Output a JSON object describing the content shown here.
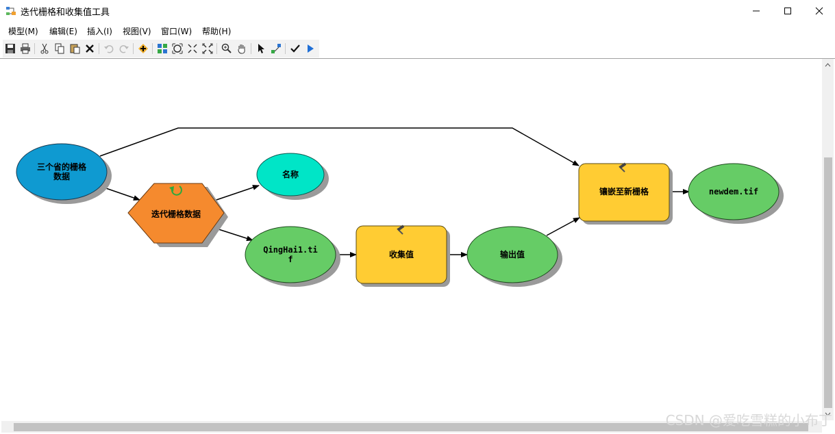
{
  "window": {
    "title": "迭代栅格和收集值工具"
  },
  "menu": [
    "模型(M)",
    "编辑(E)",
    "插入(I)",
    "视图(V)",
    "窗口(W)",
    "帮助(H)"
  ],
  "toolbar_icons": [
    "save-icon",
    "print-icon",
    "cut-icon",
    "copy-icon",
    "paste-icon",
    "delete-icon",
    "undo-icon",
    "redo-icon",
    "add-data-icon",
    "auto-layout-icon",
    "full-extent-icon",
    "zoom-in-fixed-icon",
    "zoom-out-fixed-icon",
    "zoom-in-icon",
    "pan-icon",
    "select-icon",
    "connect-icon",
    "validate-icon",
    "run-icon"
  ],
  "nodes": {
    "input_raster": {
      "line1": "三个省的栅格",
      "line2": "数据"
    },
    "iterator": {
      "label": "迭代栅格数据"
    },
    "name_var": {
      "label": "名称"
    },
    "qinghai": {
      "line1": "QingHai1.ti",
      "line2": "f"
    },
    "collect": {
      "label": "收集值"
    },
    "output_values": {
      "label": "输出值"
    },
    "mosaic": {
      "label": "镶嵌至新栅格"
    },
    "newdem": {
      "label": "newdem.tif"
    }
  },
  "colors": {
    "input_data": "#0f9ad1",
    "iterator": "#f58a2e",
    "variable": "#00e5c7",
    "derived_data": "#66cc66",
    "tool": "#ffcc33"
  },
  "watermark": "CSDN @爱吃雪糕的小布丁"
}
